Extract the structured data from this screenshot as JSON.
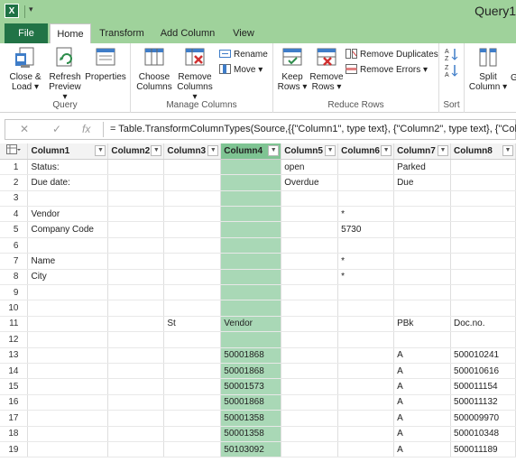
{
  "app": {
    "title": "Query1",
    "icon": "excel-icon",
    "accent": "#217346",
    "titlebar_color": "#9fd29b",
    "selected_column_color": "#a9d8b6"
  },
  "tabs": [
    "File",
    "Home",
    "Transform",
    "Add Column",
    "View"
  ],
  "ribbon": {
    "query_group": {
      "label": "Query",
      "close_load": [
        "Close &",
        "Load ▾"
      ],
      "refresh_preview": [
        "Refresh",
        "Preview ▾"
      ],
      "properties": "Properties"
    },
    "manage_columns_group": {
      "label": "Manage Columns",
      "choose_columns": [
        "Choose",
        "Columns"
      ],
      "remove_columns": [
        "Remove",
        "Columns ▾"
      ],
      "rename": "Rename",
      "move": "Move ▾"
    },
    "reduce_rows_group": {
      "label": "Reduce Rows",
      "keep_rows": [
        "Keep",
        "Rows ▾"
      ],
      "remove_rows": [
        "Remove",
        "Rows ▾"
      ],
      "remove_duplicates": "Remove Duplicates",
      "remove_errors": "Remove Errors ▾"
    },
    "sort_group": {
      "label": "Sort"
    },
    "transform_group": {
      "split_column": [
        "Split",
        "Column ▾"
      ],
      "group_by_partial": "G"
    }
  },
  "formula_bar": {
    "cancel": "✕",
    "confirm": "✓",
    "fx": "fx",
    "text": "= Table.TransformColumnTypes(Source,{{\"Column1\", type text}, {\"Column2\", type text}, {\"Colu"
  },
  "grid": {
    "columns": [
      "Column1",
      "Column2",
      "Column3",
      "Column4",
      "Column5",
      "Column6",
      "Column7",
      "Column8"
    ],
    "selected_column": "Column4",
    "rows": [
      [
        "1",
        "Status:",
        "",
        "",
        "",
        "open",
        "",
        "Parked",
        ""
      ],
      [
        "2",
        "Due date:",
        "",
        "",
        "",
        "Overdue",
        "",
        "Due",
        ""
      ],
      [
        "3",
        "",
        "",
        "",
        "",
        "",
        "",
        "",
        ""
      ],
      [
        "4",
        "  Vendor",
        "",
        "",
        "",
        "",
        "*",
        "",
        ""
      ],
      [
        "5",
        "  Company Code",
        "",
        "",
        "",
        "",
        "5730",
        "",
        ""
      ],
      [
        "6",
        "",
        "",
        "",
        "",
        "",
        "",
        "",
        ""
      ],
      [
        "7",
        "  Name",
        "",
        "",
        "",
        "",
        "*",
        "",
        ""
      ],
      [
        "8",
        "  City",
        "",
        "",
        "",
        "",
        "*",
        "",
        ""
      ],
      [
        "9",
        "",
        "",
        "",
        "",
        "",
        "",
        "",
        ""
      ],
      [
        "10",
        "",
        "",
        "",
        "",
        "",
        "",
        "",
        ""
      ],
      [
        "11",
        "",
        "",
        "St",
        "Vendor",
        "",
        "",
        "PBk",
        "Doc.no."
      ],
      [
        "12",
        "",
        "",
        "",
        "",
        "",
        "",
        "",
        ""
      ],
      [
        "13",
        "",
        "",
        "",
        "50001868",
        "",
        "",
        "A",
        "500010241"
      ],
      [
        "14",
        "",
        "",
        "",
        "50001868",
        "",
        "",
        "A",
        "500010616"
      ],
      [
        "15",
        "",
        "",
        "",
        "50001573",
        "",
        "",
        "A",
        "500011154"
      ],
      [
        "16",
        "",
        "",
        "",
        "50001868",
        "",
        "",
        "A",
        "500011132"
      ],
      [
        "17",
        "",
        "",
        "",
        "50001358",
        "",
        "",
        "A",
        "500009970"
      ],
      [
        "18",
        "",
        "",
        "",
        "50001358",
        "",
        "",
        "A",
        "500010348"
      ],
      [
        "19",
        "",
        "",
        "",
        "50103092",
        "",
        "",
        "A",
        "500011189"
      ]
    ]
  }
}
